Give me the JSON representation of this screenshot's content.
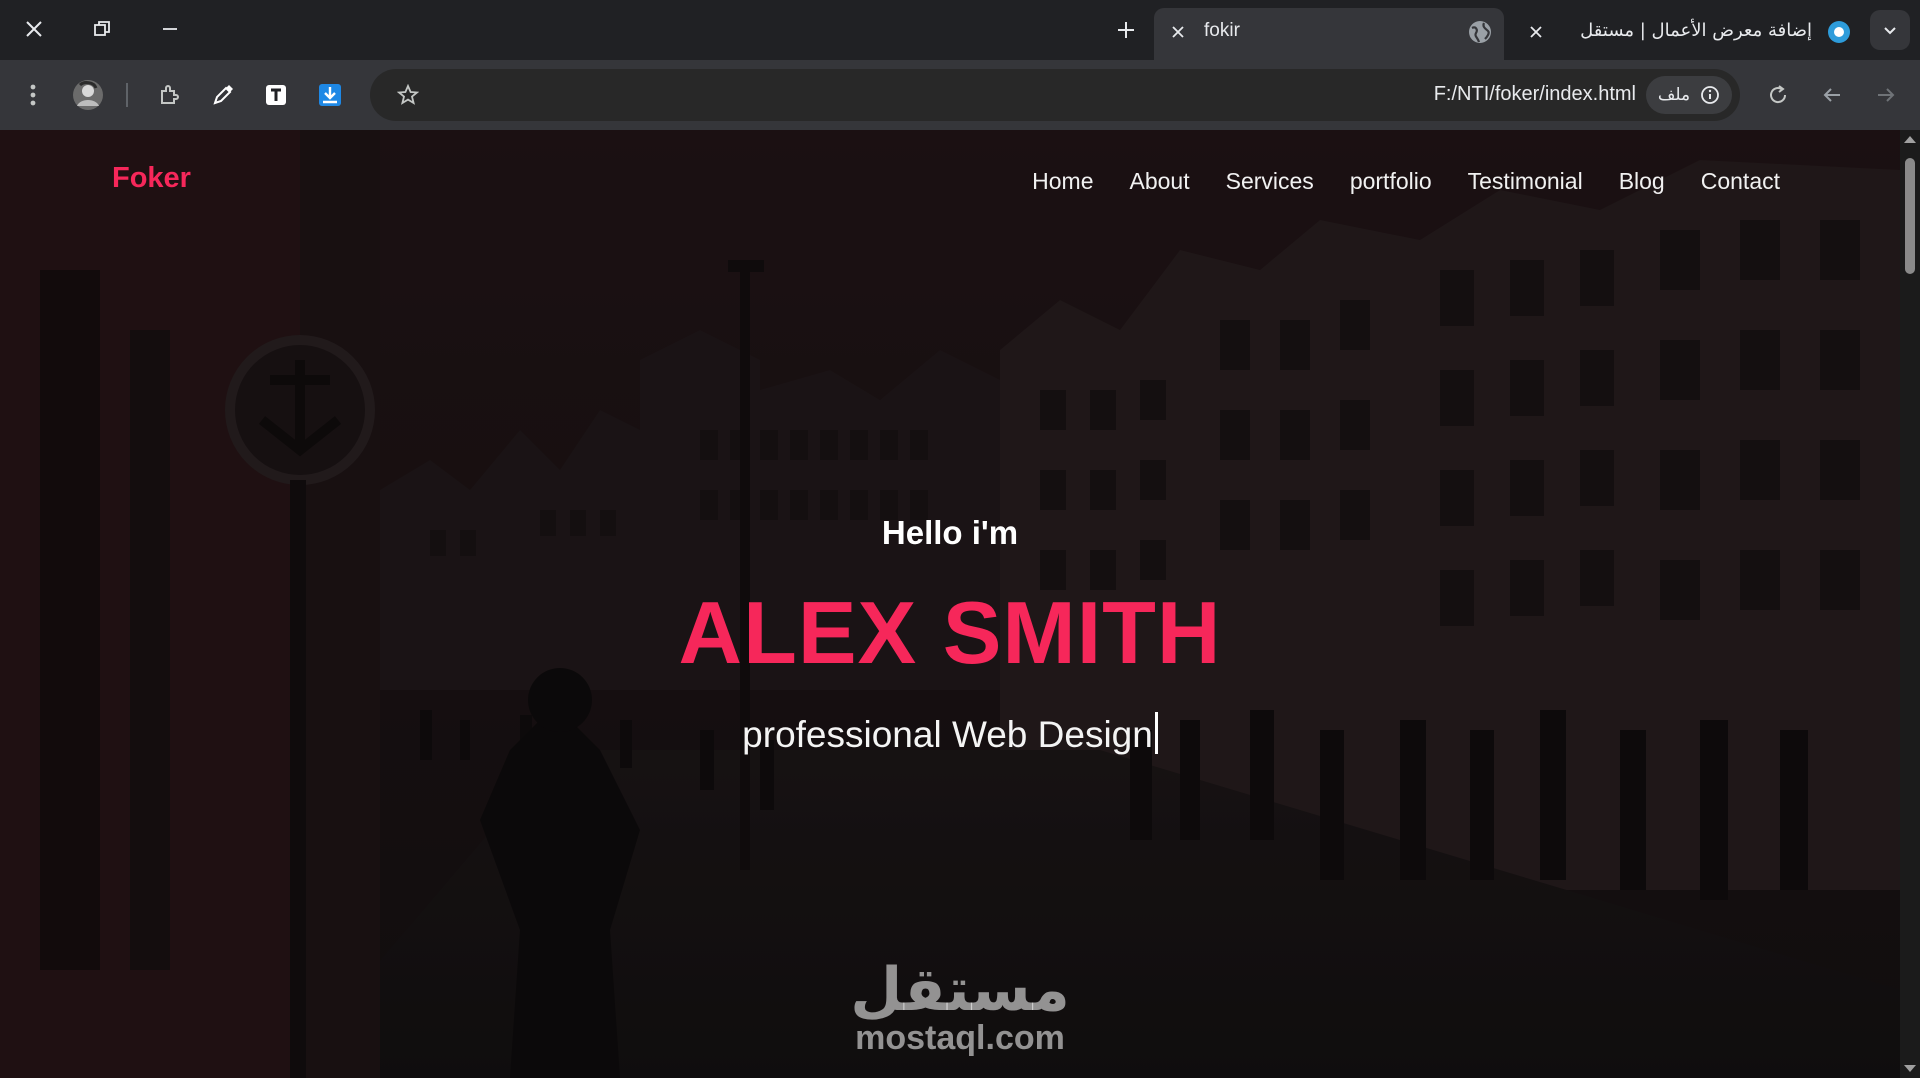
{
  "browser": {
    "tabs": [
      {
        "title": "fokir",
        "active": true,
        "favicon": "globe-icon"
      },
      {
        "title": "إضافة معرض الأعمال | مستقل",
        "active": false,
        "favicon": "mostaql-icon"
      }
    ],
    "address": {
      "url": "F:/NTI/foker/index.html",
      "site_chip": "ملف"
    },
    "toolbar_icons": [
      "menu-icon",
      "profile-avatar",
      "extensions-icon",
      "eyedropper-icon",
      "text-extension-icon",
      "download-extension-icon",
      "bookmark-star-icon",
      "reload-icon",
      "back-icon",
      "forward-icon"
    ]
  },
  "page": {
    "brand": "Foker",
    "nav": [
      "Home",
      "About",
      "Services",
      "portfolio",
      "Testimonial",
      "Blog",
      "Contact"
    ],
    "hero": {
      "greeting": "Hello i'm",
      "name": "ALEX SMITH",
      "role": "professional Web Design"
    },
    "watermark": {
      "arabic": "مستقل",
      "latin": "mostaql.com"
    }
  },
  "colors": {
    "accent": "#f6275a",
    "tab_bg": "#202124",
    "toolbar_bg": "#35363a",
    "omnibox_bg": "#282828"
  }
}
